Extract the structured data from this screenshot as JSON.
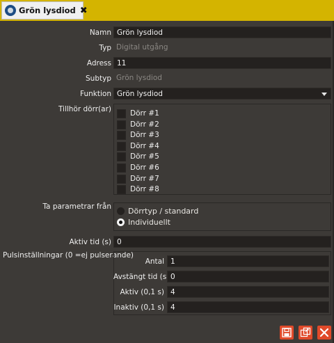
{
  "tab": {
    "title": "Grön lysdiod",
    "close_glyph": "✖",
    "icon": "led-device-icon"
  },
  "fields": {
    "namn": {
      "label": "Namn",
      "value": "Grön lysdiod"
    },
    "typ": {
      "label": "Typ",
      "value": "Digital utgång"
    },
    "adress": {
      "label": "Adress",
      "value": "11"
    },
    "subtyp": {
      "label": "Subtyp",
      "value": "Grön lysdiod"
    },
    "funktion": {
      "label": "Funktion",
      "value": "Grön lysdiod"
    }
  },
  "doors": {
    "label": "Tillhör dörr(ar)",
    "items": [
      {
        "label": "Dörr #1",
        "checked": false
      },
      {
        "label": "Dörr #2",
        "checked": false
      },
      {
        "label": "Dörr #3",
        "checked": false
      },
      {
        "label": "Dörr #4",
        "checked": false
      },
      {
        "label": "Dörr #5",
        "checked": false
      },
      {
        "label": "Dörr #6",
        "checked": false
      },
      {
        "label": "Dörr #7",
        "checked": false
      },
      {
        "label": "Dörr #8",
        "checked": false
      }
    ]
  },
  "params": {
    "label": "Ta parametrar från",
    "options": [
      {
        "label": "Dörrtyp / standard",
        "selected": false
      },
      {
        "label": "Individuellt",
        "selected": true
      }
    ]
  },
  "aktiv_tid": {
    "label": "Aktiv tid (s)",
    "value": "0"
  },
  "puls": {
    "label": "Pulsinställningar (0 =ej pulserande)",
    "antal": {
      "label": "Antal",
      "value": "1"
    },
    "avstangt": {
      "label": "Avstängt tid (s)",
      "value": "0"
    },
    "aktiv": {
      "label": "Aktiv (0,1 s)",
      "value": "4"
    },
    "inaktiv": {
      "label": "Inaktiv (0,1 s)",
      "value": "4"
    }
  },
  "actions": {
    "save": "save-icon",
    "save_copy": "save-copy-icon",
    "close": "close-icon",
    "accent": "#e04a2a"
  },
  "colors": {
    "titlebar": "#d4b400",
    "background": "#3d3a37",
    "field": "#24211f"
  }
}
